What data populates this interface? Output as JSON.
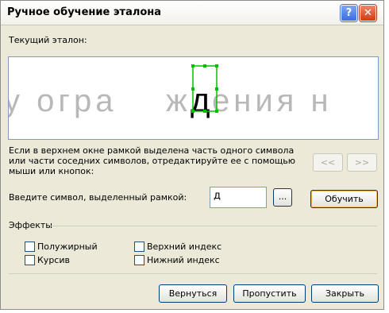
{
  "window": {
    "title": "Ручное обучение эталона"
  },
  "labels": {
    "current_template": "Текущий эталон:",
    "instructions": [
      "Если в верхнем окне рамкой выделена часть одного символа",
      "или части соседних символов, отредактируйте ее с помощью",
      "мыши или кнопок:"
    ],
    "enter_symbol": "Введите символ, выделенный рамкой:",
    "effects": "Эффекты"
  },
  "preview": {
    "text_left": "у  огра",
    "text_middle": "ж",
    "text_selected": "д",
    "text_right": "ения  н"
  },
  "input": {
    "value": "д"
  },
  "buttons": {
    "prev": "<<",
    "next": ">>",
    "browse": "...",
    "train": "Обучить",
    "back": "Вернуться",
    "skip": "Пропустить",
    "close": "Закрыть"
  },
  "checkboxes": {
    "bold": "Полужирный",
    "italic": "Курсив",
    "superscript": "Верхний индекс",
    "subscript": "Нижний индекс"
  }
}
